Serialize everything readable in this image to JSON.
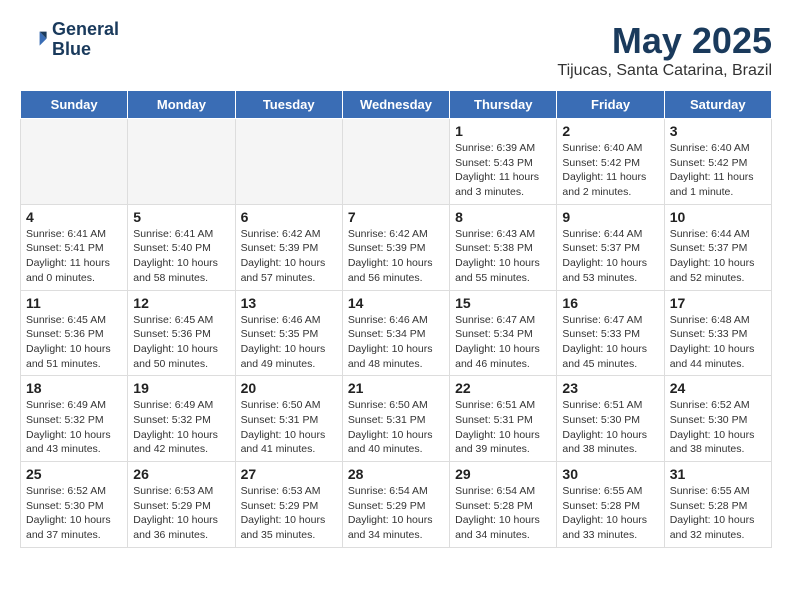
{
  "header": {
    "logo_line1": "General",
    "logo_line2": "Blue",
    "title": "May 2025",
    "subtitle": "Tijucas, Santa Catarina, Brazil"
  },
  "days_of_week": [
    "Sunday",
    "Monday",
    "Tuesday",
    "Wednesday",
    "Thursday",
    "Friday",
    "Saturday"
  ],
  "weeks": [
    [
      {
        "num": "",
        "info": "",
        "empty": true
      },
      {
        "num": "",
        "info": "",
        "empty": true
      },
      {
        "num": "",
        "info": "",
        "empty": true
      },
      {
        "num": "",
        "info": "",
        "empty": true
      },
      {
        "num": "1",
        "info": "Sunrise: 6:39 AM\nSunset: 5:43 PM\nDaylight: 11 hours\nand 3 minutes.",
        "empty": false
      },
      {
        "num": "2",
        "info": "Sunrise: 6:40 AM\nSunset: 5:42 PM\nDaylight: 11 hours\nand 2 minutes.",
        "empty": false
      },
      {
        "num": "3",
        "info": "Sunrise: 6:40 AM\nSunset: 5:42 PM\nDaylight: 11 hours\nand 1 minute.",
        "empty": false
      }
    ],
    [
      {
        "num": "4",
        "info": "Sunrise: 6:41 AM\nSunset: 5:41 PM\nDaylight: 11 hours\nand 0 minutes.",
        "empty": false
      },
      {
        "num": "5",
        "info": "Sunrise: 6:41 AM\nSunset: 5:40 PM\nDaylight: 10 hours\nand 58 minutes.",
        "empty": false
      },
      {
        "num": "6",
        "info": "Sunrise: 6:42 AM\nSunset: 5:39 PM\nDaylight: 10 hours\nand 57 minutes.",
        "empty": false
      },
      {
        "num": "7",
        "info": "Sunrise: 6:42 AM\nSunset: 5:39 PM\nDaylight: 10 hours\nand 56 minutes.",
        "empty": false
      },
      {
        "num": "8",
        "info": "Sunrise: 6:43 AM\nSunset: 5:38 PM\nDaylight: 10 hours\nand 55 minutes.",
        "empty": false
      },
      {
        "num": "9",
        "info": "Sunrise: 6:44 AM\nSunset: 5:37 PM\nDaylight: 10 hours\nand 53 minutes.",
        "empty": false
      },
      {
        "num": "10",
        "info": "Sunrise: 6:44 AM\nSunset: 5:37 PM\nDaylight: 10 hours\nand 52 minutes.",
        "empty": false
      }
    ],
    [
      {
        "num": "11",
        "info": "Sunrise: 6:45 AM\nSunset: 5:36 PM\nDaylight: 10 hours\nand 51 minutes.",
        "empty": false
      },
      {
        "num": "12",
        "info": "Sunrise: 6:45 AM\nSunset: 5:36 PM\nDaylight: 10 hours\nand 50 minutes.",
        "empty": false
      },
      {
        "num": "13",
        "info": "Sunrise: 6:46 AM\nSunset: 5:35 PM\nDaylight: 10 hours\nand 49 minutes.",
        "empty": false
      },
      {
        "num": "14",
        "info": "Sunrise: 6:46 AM\nSunset: 5:34 PM\nDaylight: 10 hours\nand 48 minutes.",
        "empty": false
      },
      {
        "num": "15",
        "info": "Sunrise: 6:47 AM\nSunset: 5:34 PM\nDaylight: 10 hours\nand 46 minutes.",
        "empty": false
      },
      {
        "num": "16",
        "info": "Sunrise: 6:47 AM\nSunset: 5:33 PM\nDaylight: 10 hours\nand 45 minutes.",
        "empty": false
      },
      {
        "num": "17",
        "info": "Sunrise: 6:48 AM\nSunset: 5:33 PM\nDaylight: 10 hours\nand 44 minutes.",
        "empty": false
      }
    ],
    [
      {
        "num": "18",
        "info": "Sunrise: 6:49 AM\nSunset: 5:32 PM\nDaylight: 10 hours\nand 43 minutes.",
        "empty": false
      },
      {
        "num": "19",
        "info": "Sunrise: 6:49 AM\nSunset: 5:32 PM\nDaylight: 10 hours\nand 42 minutes.",
        "empty": false
      },
      {
        "num": "20",
        "info": "Sunrise: 6:50 AM\nSunset: 5:31 PM\nDaylight: 10 hours\nand 41 minutes.",
        "empty": false
      },
      {
        "num": "21",
        "info": "Sunrise: 6:50 AM\nSunset: 5:31 PM\nDaylight: 10 hours\nand 40 minutes.",
        "empty": false
      },
      {
        "num": "22",
        "info": "Sunrise: 6:51 AM\nSunset: 5:31 PM\nDaylight: 10 hours\nand 39 minutes.",
        "empty": false
      },
      {
        "num": "23",
        "info": "Sunrise: 6:51 AM\nSunset: 5:30 PM\nDaylight: 10 hours\nand 38 minutes.",
        "empty": false
      },
      {
        "num": "24",
        "info": "Sunrise: 6:52 AM\nSunset: 5:30 PM\nDaylight: 10 hours\nand 38 minutes.",
        "empty": false
      }
    ],
    [
      {
        "num": "25",
        "info": "Sunrise: 6:52 AM\nSunset: 5:30 PM\nDaylight: 10 hours\nand 37 minutes.",
        "empty": false
      },
      {
        "num": "26",
        "info": "Sunrise: 6:53 AM\nSunset: 5:29 PM\nDaylight: 10 hours\nand 36 minutes.",
        "empty": false
      },
      {
        "num": "27",
        "info": "Sunrise: 6:53 AM\nSunset: 5:29 PM\nDaylight: 10 hours\nand 35 minutes.",
        "empty": false
      },
      {
        "num": "28",
        "info": "Sunrise: 6:54 AM\nSunset: 5:29 PM\nDaylight: 10 hours\nand 34 minutes.",
        "empty": false
      },
      {
        "num": "29",
        "info": "Sunrise: 6:54 AM\nSunset: 5:28 PM\nDaylight: 10 hours\nand 34 minutes.",
        "empty": false
      },
      {
        "num": "30",
        "info": "Sunrise: 6:55 AM\nSunset: 5:28 PM\nDaylight: 10 hours\nand 33 minutes.",
        "empty": false
      },
      {
        "num": "31",
        "info": "Sunrise: 6:55 AM\nSunset: 5:28 PM\nDaylight: 10 hours\nand 32 minutes.",
        "empty": false
      }
    ]
  ]
}
